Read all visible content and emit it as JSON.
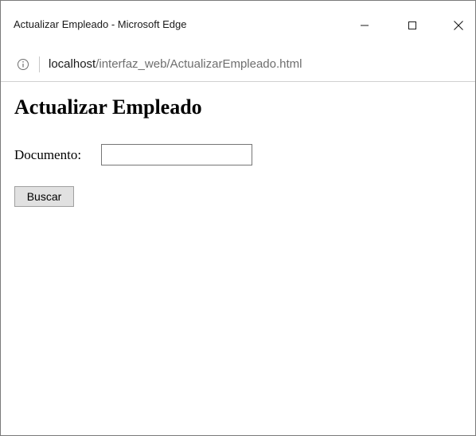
{
  "window": {
    "title": "Actualizar Empleado - Microsoft Edge"
  },
  "titlebar_buttons": {
    "minimize_icon": "minimize-icon",
    "maximize_icon": "maximize-icon",
    "close_icon": "close-icon"
  },
  "addressbar": {
    "info_icon": "info-icon",
    "url_host": "localhost",
    "url_path": "/interfaz_web/ActualizarEmpleado.html"
  },
  "page": {
    "title": "Actualizar Empleado",
    "documento_label": "Documento:",
    "documento_value": "",
    "buscar_label": "Buscar"
  },
  "colors": {
    "window_border": "#7a7a7a",
    "url_path": "#6e6e6e",
    "button_bg": "#e1e1e1"
  }
}
